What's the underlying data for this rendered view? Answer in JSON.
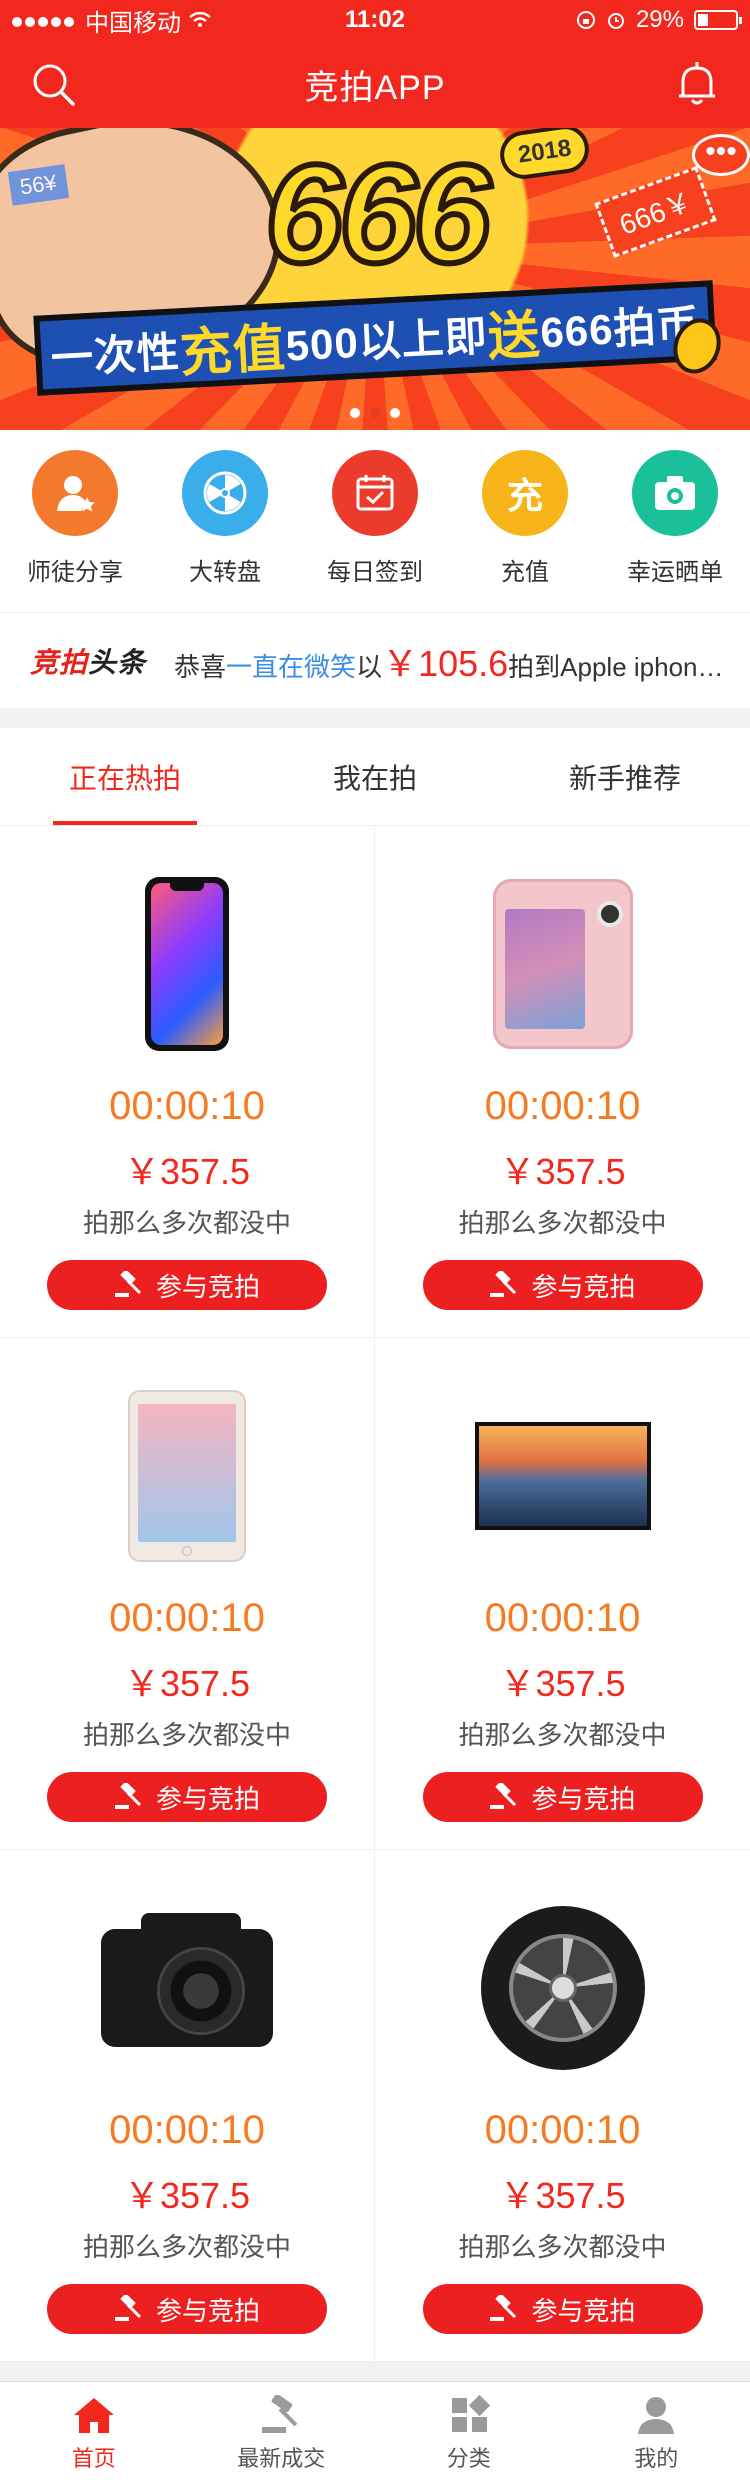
{
  "status_bar": {
    "carrier": "中国移动",
    "time": "11:02",
    "battery": "29%"
  },
  "header": {
    "title": "竞拍APP"
  },
  "banner": {
    "big_text": "666",
    "year": "2018",
    "tag_right": "666￥",
    "tag_left": "56¥",
    "slogan_a": "一次性",
    "slogan_b": "充值",
    "slogan_c": "500以上即",
    "slogan_d": "送",
    "slogan_e": "666拍币",
    "pages": 3,
    "active_page": 2
  },
  "quick_menu": [
    {
      "label": "师徒分享",
      "icon": "user-star-icon",
      "color": "#f37a2c"
    },
    {
      "label": "大转盘",
      "icon": "wheel-icon",
      "color": "#3aaeea"
    },
    {
      "label": "每日签到",
      "icon": "calendar-check-icon",
      "color": "#ec3a2c"
    },
    {
      "label": "充值",
      "icon": "recharge-icon",
      "glyph": "充",
      "color": "#f7b419"
    },
    {
      "label": "幸运晒单",
      "icon": "camera-icon",
      "color": "#19c09a"
    }
  ],
  "headline": {
    "logo_a": "竞拍",
    "logo_b": "头条",
    "prefix": "恭喜",
    "user": "一直在微笑",
    "mid": "以",
    "price": "￥105.6",
    "suffix": "拍到Apple iphone X"
  },
  "tabs": [
    {
      "label": "正在热拍",
      "active": true
    },
    {
      "label": "我在拍",
      "active": false
    },
    {
      "label": "新手推荐",
      "active": false
    }
  ],
  "products": [
    {
      "image": "iphone",
      "timer": "00:00:10",
      "price": "￥357.5",
      "desc": "拍那么多次都没中",
      "button": "参与竞拍"
    },
    {
      "image": "pink-phone",
      "timer": "00:00:10",
      "price": "￥357.5",
      "desc": "拍那么多次都没中",
      "button": "参与竞拍"
    },
    {
      "image": "ipad",
      "timer": "00:00:10",
      "price": "￥357.5",
      "desc": "拍那么多次都没中",
      "button": "参与竞拍"
    },
    {
      "image": "tv",
      "timer": "00:00:10",
      "price": "￥357.5",
      "desc": "拍那么多次都没中",
      "button": "参与竞拍"
    },
    {
      "image": "camera",
      "timer": "00:00:10",
      "price": "￥357.5",
      "desc": "拍那么多次都没中",
      "button": "参与竞拍"
    },
    {
      "image": "tire",
      "timer": "00:00:10",
      "price": "￥357.5",
      "desc": "拍那么多次都没中",
      "button": "参与竞拍"
    }
  ],
  "tab_bar": [
    {
      "label": "首页",
      "icon": "home-icon",
      "active": true
    },
    {
      "label": "最新成交",
      "icon": "gavel-icon",
      "active": false
    },
    {
      "label": "分类",
      "icon": "category-icon",
      "active": false
    },
    {
      "label": "我的",
      "icon": "profile-icon",
      "active": false
    }
  ],
  "colors": {
    "brand_red": "#f2281e",
    "timer_orange": "#f57a20",
    "link_blue": "#3a8ee6"
  }
}
